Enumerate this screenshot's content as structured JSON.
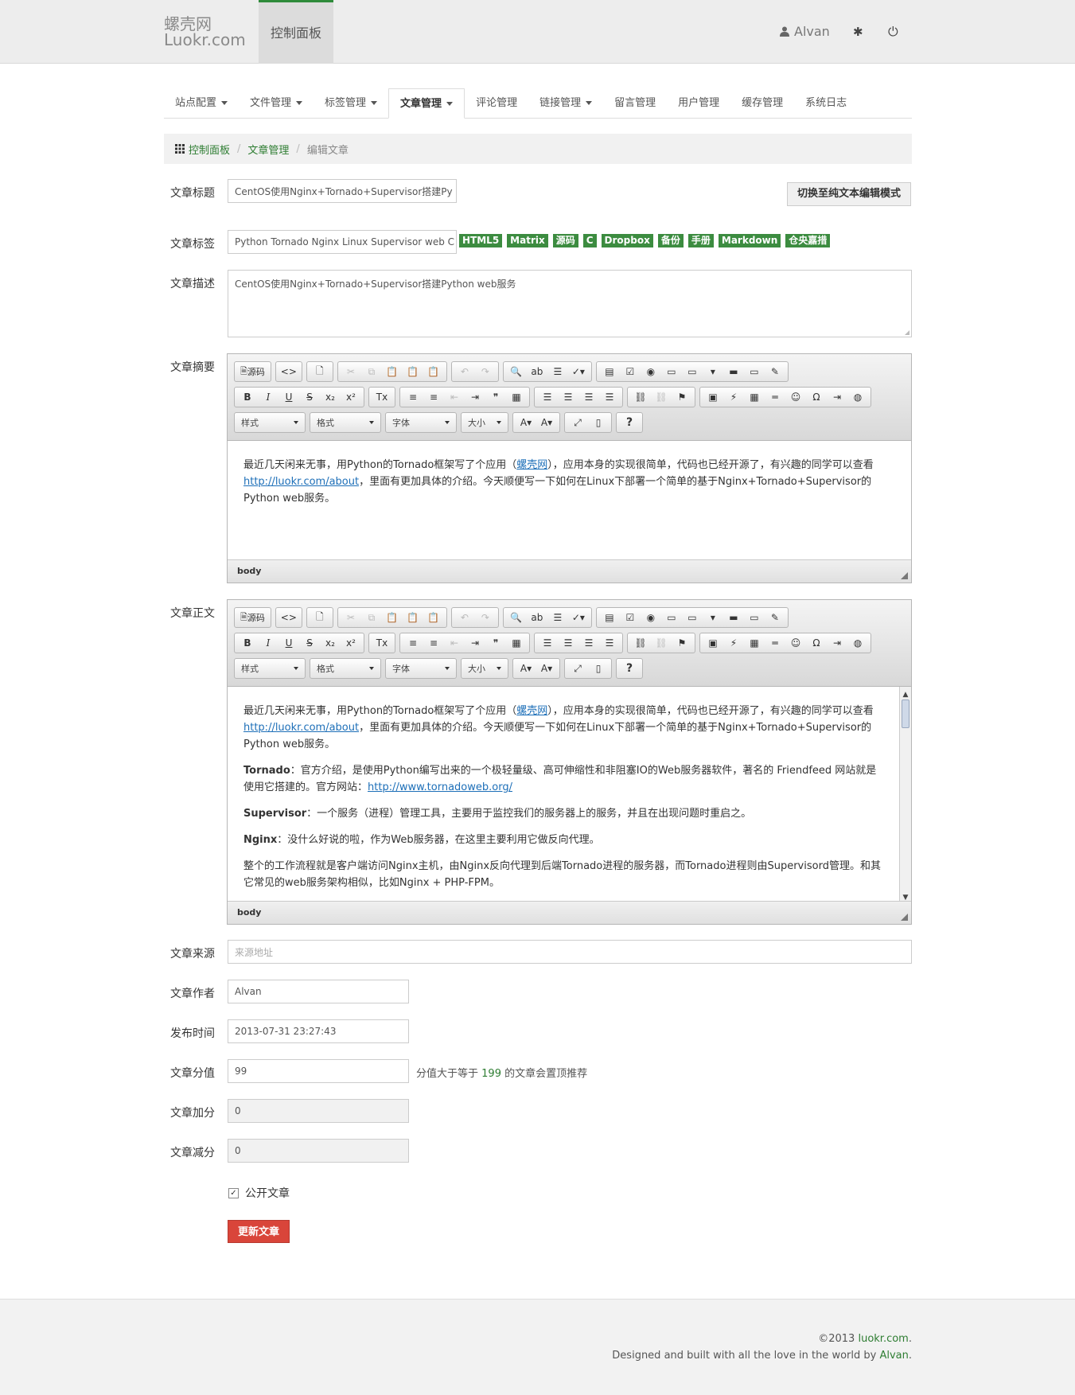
{
  "header": {
    "brand_cn": "螺壳网",
    "brand_en": "Luokr.com",
    "active_nav": "控制面板",
    "user": "Alvan"
  },
  "tabs": [
    {
      "label": "站点配置",
      "caret": true
    },
    {
      "label": "文件管理",
      "caret": true
    },
    {
      "label": "标签管理",
      "caret": true
    },
    {
      "label": "文章管理",
      "caret": true,
      "active": true
    },
    {
      "label": "评论管理",
      "caret": false
    },
    {
      "label": "链接管理",
      "caret": true
    },
    {
      "label": "留言管理",
      "caret": false
    },
    {
      "label": "用户管理",
      "caret": false
    },
    {
      "label": "缓存管理",
      "caret": false
    },
    {
      "label": "系统日志",
      "caret": false
    }
  ],
  "breadcrumb": {
    "home": "控制面板",
    "section": "文章管理",
    "current": "编辑文章"
  },
  "form": {
    "title_label": "文章标题",
    "title_value": "CentOS使用Nginx+Tornado+Supervisor搭建Py",
    "switch_button": "切换至纯文本编辑模式",
    "tags_label": "文章标签",
    "tags_value": "Python Tornado Nginx Linux Supervisor web C",
    "tag_suggestions": [
      "HTML5",
      "Matrix",
      "源码",
      "C",
      "Dropbox",
      "备份",
      "手册",
      "Markdown",
      "仓央嘉措"
    ],
    "desc_label": "文章描述",
    "desc_value": "CentOS使用Nginx+Tornado+Supervisor搭建Python web服务",
    "summary_label": "文章摘要",
    "body_label": "文章正文",
    "source_label": "文章来源",
    "source_placeholder": "来源地址",
    "author_label": "文章作者",
    "author_value": "Alvan",
    "time_label": "发布时间",
    "time_value": "2013-07-31 23:27:43",
    "score_label": "文章分值",
    "score_value": "99",
    "score_hint_pre": "分值大于等于",
    "score_hint_num": "199",
    "score_hint_post": "的文章会置顶推荐",
    "plus_label": "文章加分",
    "plus_value": "0",
    "minus_label": "文章减分",
    "minus_value": "0",
    "public_label": "公开文章",
    "submit": "更新文章"
  },
  "editor": {
    "source_btn": "源码",
    "style_combo": "样式",
    "format_combo": "格式",
    "font_combo": "字体",
    "size_combo": "大小",
    "path": "body"
  },
  "summary_content": {
    "p1_a": "最近几天闲来无事，用Python的Tornado框架写了个应用（",
    "p1_link": "螺壳网",
    "p1_b": "），应用本身的实现很简单，代码也已经开源了，有兴趣的同学可以查看",
    "p1_link2": "http://luokr.com/about",
    "p1_c": "，里面有更加具体的介绍。今天顺便写一下如何在Linux下部署一个简单的基于Nginx+Tornado+Supervisor的Python web服务。"
  },
  "body_content": {
    "p2_bold": "Tornado",
    "p2_text": "：官方介绍，是使用Python编写出来的一个极轻量级、高可伸缩性和非阻塞IO的Web服务器软件，著名的 Friendfeed 网站就是使用它搭建的。官方网站：",
    "p2_link": "http://www.tornadoweb.org/",
    "p3_bold": "Supervisor",
    "p3_text": "：一个服务（进程）管理工具，主要用于监控我们的服务器上的服务，并且在出现问题时重启之。",
    "p4_bold": "Nginx",
    "p4_text": "：没什么好说的啦，作为Web服务器，在这里主要利用它做反向代理。",
    "p5_text": "整个的工作流程就是客户端访问Nginx主机，由Nginx反向代理到后端Tornado进程的服务器，而Tornado进程则由Supervisord管理。和其它常见的web服务架构相似，比如Nginx + PHP-FPM。"
  },
  "footer": {
    "copy": "©2013",
    "site": "luokr.com",
    "dot": ".",
    "line2": "Designed and built with all the love in the world by",
    "author": "Alvan",
    "dot2": "."
  }
}
